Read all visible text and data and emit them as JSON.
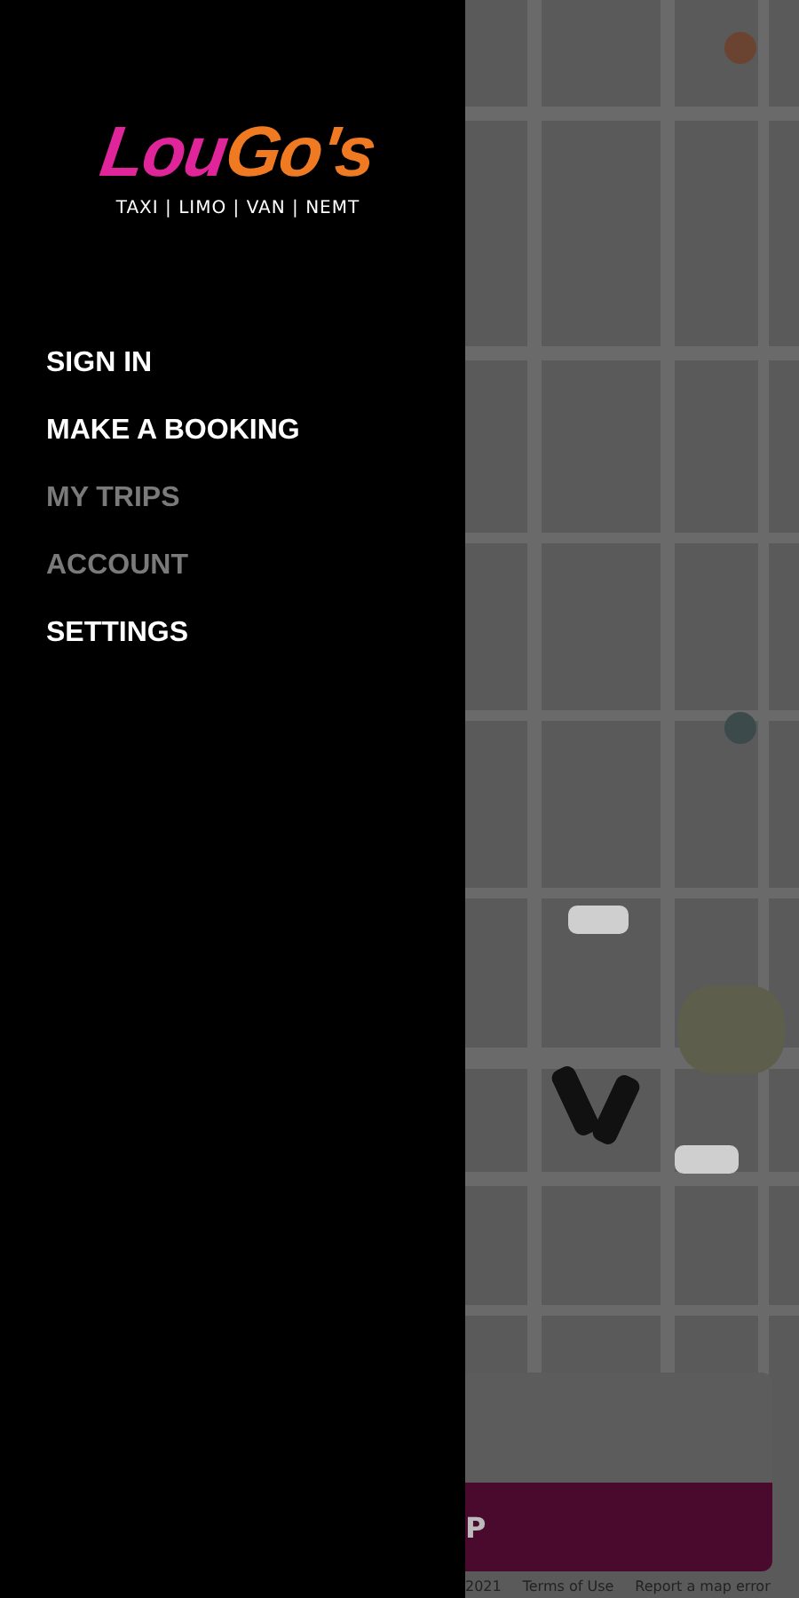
{
  "drawer": {
    "logo": {
      "first": "Lou",
      "second": "Go's"
    },
    "tagline": "TAXI | LIMO | VAN | NEMT",
    "menu": [
      {
        "label": "SIGN IN",
        "disabled": false
      },
      {
        "label": "MAKE A BOOKING",
        "disabled": false
      },
      {
        "label": "MY TRIPS",
        "disabled": true
      },
      {
        "label": "ACCOUNT",
        "disabled": true
      },
      {
        "label": "SETTINGS",
        "disabled": false
      }
    ]
  },
  "map": {
    "kind": "picture",
    "action_button": "P",
    "footer": [
      "2021",
      "Terms of Use",
      "Report a map error"
    ]
  }
}
